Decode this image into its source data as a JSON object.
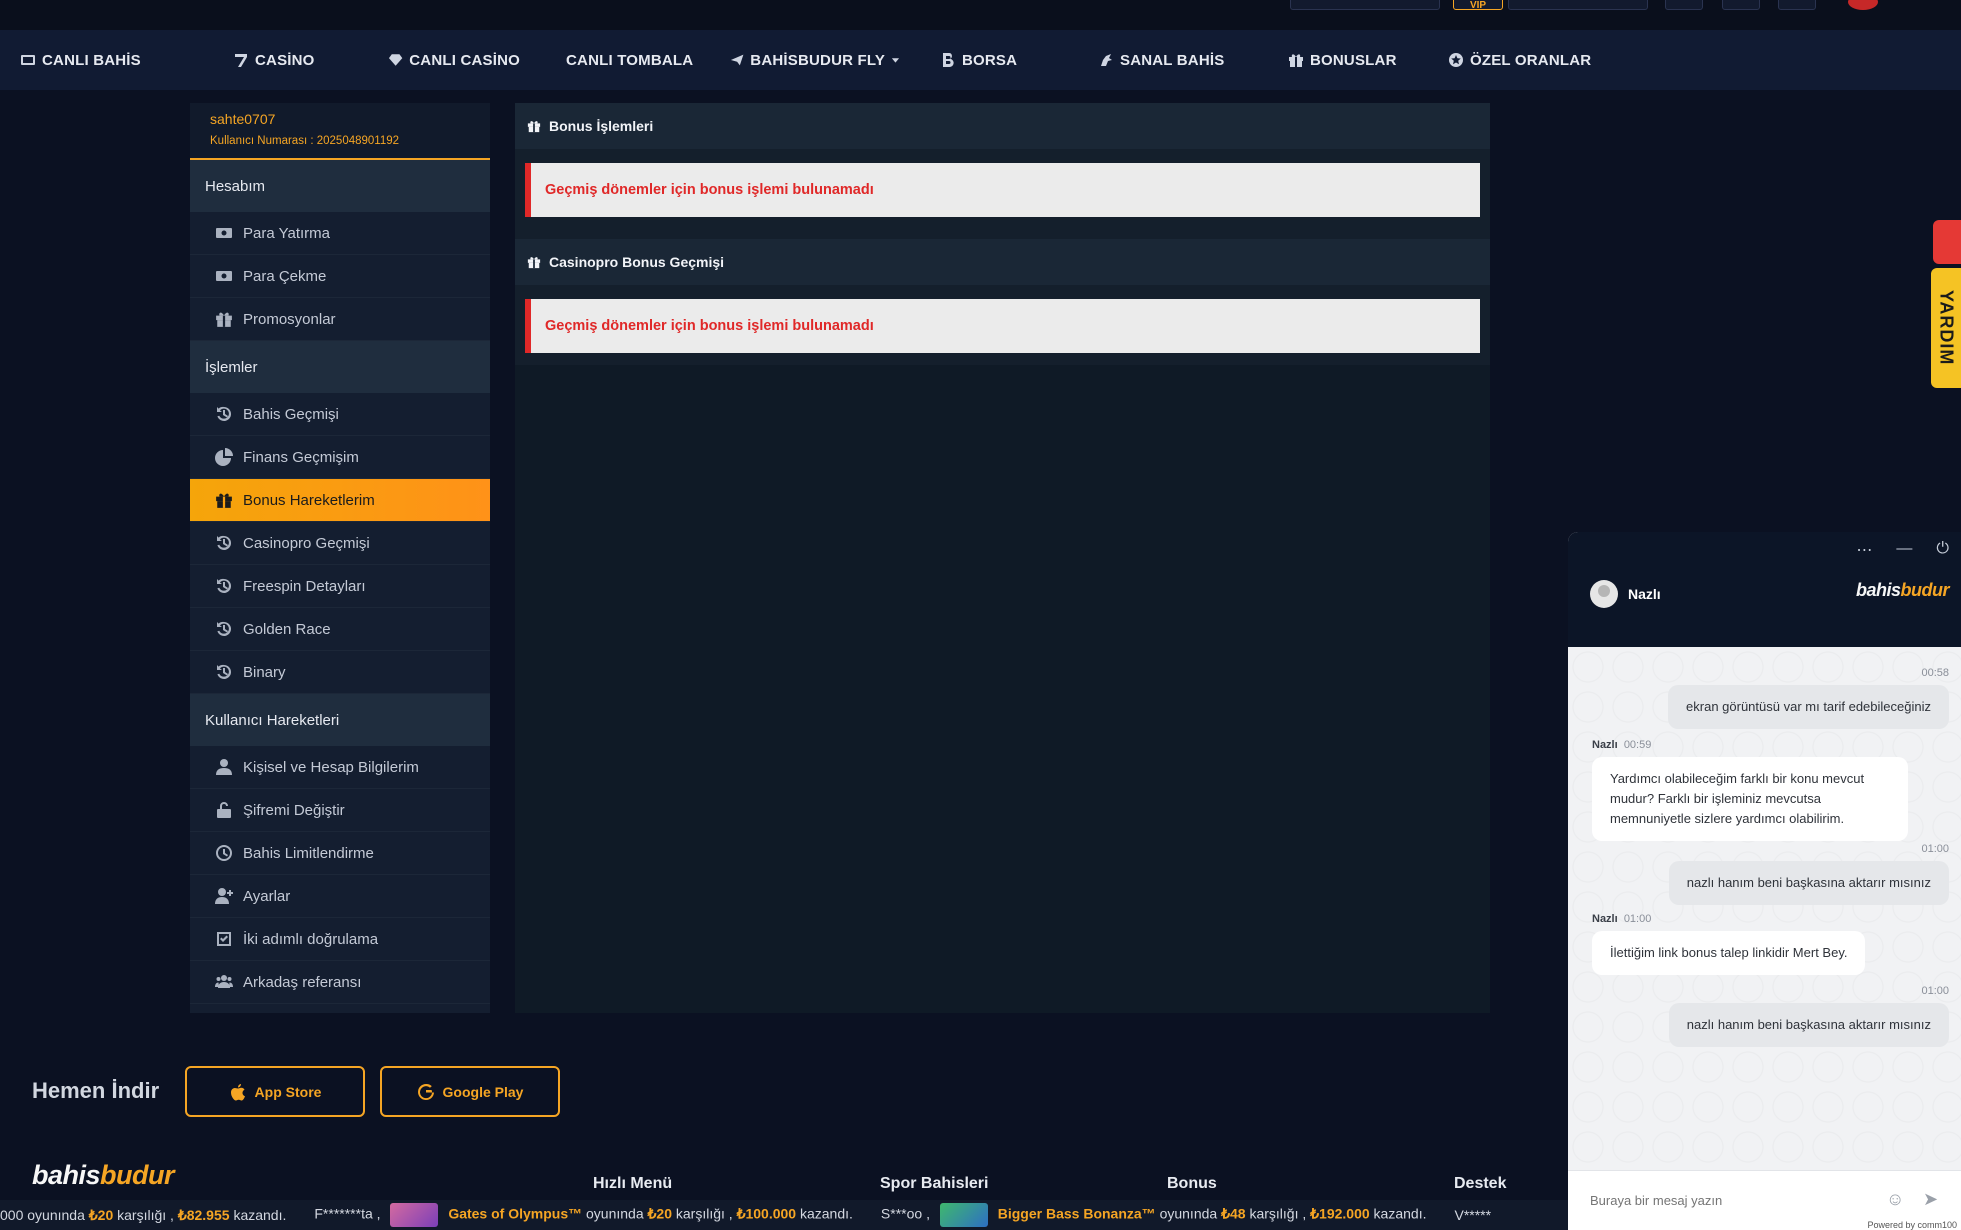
{
  "nav": {
    "items": [
      {
        "label": "CANLI BAHİS",
        "icon": "tv-icon"
      },
      {
        "label": "CASİNO",
        "icon": "seven-icon"
      },
      {
        "label": "CANLI CASİNO",
        "icon": "diamond-icon"
      },
      {
        "label": "CANLI TOMBALA",
        "icon": "balls-icon"
      },
      {
        "label": "BAHİSBUDUR FLY",
        "icon": "plane-icon"
      },
      {
        "label": "BORSA",
        "icon": "b-icon"
      },
      {
        "label": "SANAL BAHİS",
        "icon": "horse-icon"
      },
      {
        "label": "BONUSLAR",
        "icon": "gift-icon"
      },
      {
        "label": "ÖZEL ORANLAR",
        "icon": "star-circle-icon"
      }
    ],
    "vip_label": "VIP"
  },
  "user": {
    "name": "sahte0707",
    "number": "Kullanıcı Numarası : 2025048901192"
  },
  "sidebar": {
    "sections": [
      {
        "title": "Hesabım",
        "items": [
          {
            "label": "Para Yatırma",
            "icon": "money-icon"
          },
          {
            "label": "Para Çekme",
            "icon": "money-icon"
          },
          {
            "label": "Promosyonlar",
            "icon": "gift-icon"
          }
        ]
      },
      {
        "title": "İşlemler",
        "items": [
          {
            "label": "Bahis Geçmişi",
            "icon": "history-icon"
          },
          {
            "label": "Finans Geçmişim",
            "icon": "pie-chart-icon"
          },
          {
            "label": "Bonus Hareketlerim",
            "icon": "gift-icon"
          },
          {
            "label": "Casinopro Geçmişi",
            "icon": "history-icon"
          },
          {
            "label": "Freespin Detayları",
            "icon": "history-icon"
          },
          {
            "label": "Golden Race",
            "icon": "history-icon"
          },
          {
            "label": "Binary",
            "icon": "history-icon"
          }
        ]
      },
      {
        "title": "Kullanıcı Hareketleri",
        "items": [
          {
            "label": "Kişisel ve Hesap Bilgilerim",
            "icon": "user-icon"
          },
          {
            "label": "Şifremi Değiştir",
            "icon": "unlock-icon"
          },
          {
            "label": "Bahis Limitlendirme",
            "icon": "clock-icon"
          },
          {
            "label": "Ayarlar",
            "icon": "user-plus-icon"
          },
          {
            "label": "İki adımlı doğrulama",
            "icon": "check-square-icon"
          },
          {
            "label": "Arkadaş referansı",
            "icon": "users-icon"
          }
        ]
      }
    ],
    "active": "Bonus Hareketlerim"
  },
  "main": {
    "panels": [
      {
        "title": "Bonus İşlemleri",
        "message": "Geçmiş dönemler için bonus işlemi bulunamadı"
      },
      {
        "title": "Casinopro Bonus Geçmişi",
        "message": "Geçmiş dönemler için bonus işlemi bulunamadı"
      }
    ]
  },
  "download": {
    "title": "Hemen İndir",
    "app_store": "App Store",
    "google_play": "Google Play"
  },
  "footer": {
    "logo_first": "bahis",
    "logo_second": "budur",
    "columns": [
      "Hızlı Menü",
      "Spor Bahisleri",
      "Bonus",
      "Destek"
    ]
  },
  "ticker": {
    "seg1": {
      "pre": "000 oyunında",
      "stake": "₺20",
      "mid": "karşılığı ,",
      "win": "₺82.955",
      "post": "kazandı."
    },
    "seg2": {
      "user": "F*******ta ,",
      "game": "Gates of Olympus™",
      "mid1": "oyunında",
      "stake": "₺20",
      "mid2": "karşılığı ,",
      "win": "₺100.000",
      "post": "kazandı."
    },
    "seg3": {
      "user": "S***oo ,",
      "game": "Bigger Bass Bonanza™",
      "mid1": "oyunında",
      "stake": "₺48",
      "mid2": "karşılığı ,",
      "win": "₺192.000",
      "post": "kazandı."
    },
    "seg4": {
      "user": "V*****"
    }
  },
  "side_tab": {
    "label": "YARDIM"
  },
  "chat": {
    "agent_name": "Nazlı",
    "logo_first": "bahis",
    "logo_second": "budur",
    "messages": [
      {
        "from": "user",
        "time": "00:58",
        "text": "ekran görüntüsü var mı tarif edebileceğiniz"
      },
      {
        "from": "agent",
        "name": "Nazlı",
        "time": "00:59",
        "text": "Yardımcı olabileceğim farklı bir konu mevcut mudur? Farklı bir işleminiz mevcutsa memnuniyetle sizlere yardımcı olabilirim."
      },
      {
        "from": "user",
        "time": "01:00",
        "text": "nazlı hanım beni başkasına aktarır mısınız"
      },
      {
        "from": "agent",
        "name": "Nazlı",
        "time": "01:00",
        "text": "İlettiğim link bonus talep linkidir Mert Bey."
      },
      {
        "from": "user",
        "time": "01:00",
        "text": "nazlı hanım beni başkasına aktarır mısınız"
      }
    ],
    "input_placeholder": "Buraya bir mesaj yazın",
    "powered": "Powered by comm100"
  }
}
